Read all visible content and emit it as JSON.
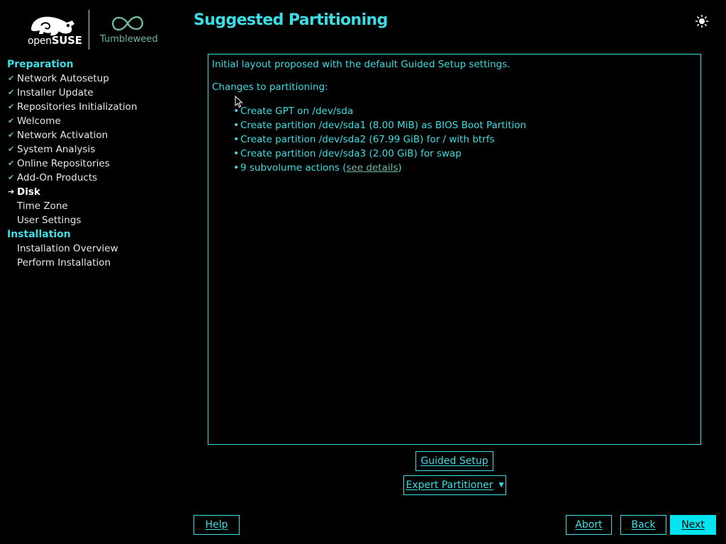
{
  "logo": {
    "brand": "openSUSE",
    "brand_prefix": "open",
    "brand_suffix": "SUSE",
    "product": "Tumbleweed"
  },
  "header": {
    "title": "Suggested Partitioning",
    "theme_icon": "sun-icon"
  },
  "sidebar": {
    "groups": [
      {
        "label": "Preparation",
        "steps": [
          {
            "label": "Network Autosetup",
            "state": "done"
          },
          {
            "label": "Installer Update",
            "state": "done"
          },
          {
            "label": "Repositories Initialization",
            "state": "done"
          },
          {
            "label": "Welcome",
            "state": "done"
          },
          {
            "label": "Network Activation",
            "state": "done"
          },
          {
            "label": "System Analysis",
            "state": "done"
          },
          {
            "label": "Online Repositories",
            "state": "done"
          },
          {
            "label": "Add-On Products",
            "state": "done"
          },
          {
            "label": "Disk",
            "state": "current"
          },
          {
            "label": "Time Zone",
            "state": "pending"
          },
          {
            "label": "User Settings",
            "state": "pending"
          }
        ]
      },
      {
        "label": "Installation",
        "steps": [
          {
            "label": "Installation Overview",
            "state": "pending"
          },
          {
            "label": "Perform Installation",
            "state": "pending"
          }
        ]
      }
    ],
    "done_mark": "✔",
    "current_mark": "➔"
  },
  "main": {
    "intro": "Initial layout proposed with the default Guided Setup settings.",
    "changes_heading": "Changes to partitioning:",
    "changes": [
      "Create GPT on /dev/sda",
      "Create partition /dev/sda1 (8.00 MiB) as BIOS Boot Partition",
      "Create partition /dev/sda2 (67.99 GiB) for / with btrfs",
      "Create partition /dev/sda3 (2.00 GiB) for swap"
    ],
    "subvolume_prefix": "9 subvolume actions (",
    "subvolume_link": "see details",
    "subvolume_suffix": ")"
  },
  "buttons": {
    "guided_setup": "Guided Setup",
    "expert_partitioner": "Expert Partitioner",
    "help": "Help",
    "abort": "Abort",
    "back": "Back",
    "next": "Next"
  },
  "colors": {
    "accent": "#3adfe6",
    "green": "#73ba9a",
    "background": "#000000",
    "primary_button": "#00e5f0"
  }
}
